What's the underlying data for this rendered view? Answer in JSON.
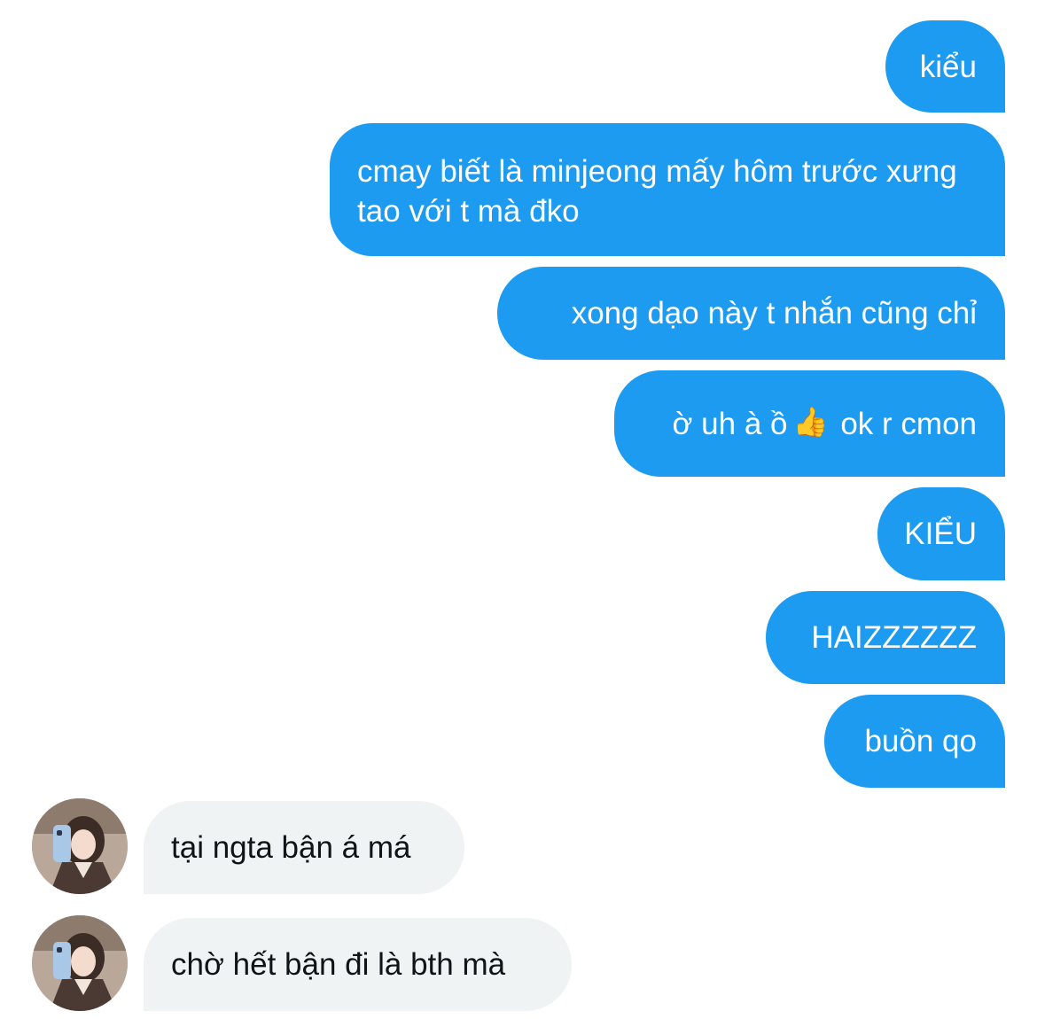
{
  "conversation": {
    "sent_messages": [
      {
        "text": "kiểu"
      },
      {
        "text": "cmay biết là minjeong mấy hôm trước xưng tao với t mà đko"
      },
      {
        "text": "xong dạo này t nhắn cũng chỉ"
      },
      {
        "text_before": "ờ uh à ồ",
        "emoji": "thumbs-up-icon",
        "text_after": "ok r cmon"
      },
      {
        "text": "KIỂU"
      },
      {
        "text": "HAIZZZZZZ"
      },
      {
        "text": "buồn qo"
      }
    ],
    "received_messages": [
      {
        "text": "tại ngta bận á má"
      },
      {
        "text": "chờ hết bận đi là bth mà"
      }
    ]
  },
  "colors": {
    "sent_bubble": "#1d9bf0",
    "sent_text": "#ffffff",
    "received_bubble": "#eff3f4",
    "received_text": "#0f1419"
  }
}
